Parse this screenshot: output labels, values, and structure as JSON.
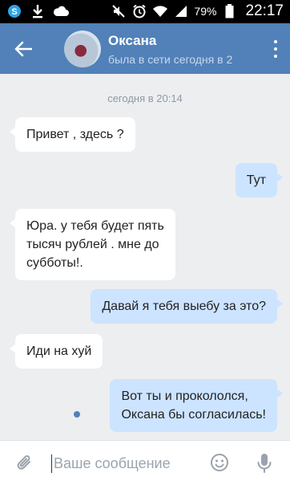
{
  "status_bar": {
    "battery": "79%",
    "time": "22:17"
  },
  "header": {
    "name": "Оксана",
    "last_seen": "была в сети сегодня в 2"
  },
  "chat": {
    "date_separator": "сегодня в 20:14",
    "messages": [
      {
        "direction": "incoming",
        "lines": [
          "Привет , здесь ?"
        ]
      },
      {
        "direction": "outgoing",
        "lines": [
          "Тут"
        ]
      },
      {
        "direction": "incoming",
        "lines": [
          "Юра. у тебя будет пять",
          "тысяч рублей . мне до",
          "субботы!."
        ]
      },
      {
        "direction": "outgoing",
        "lines": [
          "Давай я тебя выебу за это?"
        ]
      },
      {
        "direction": "incoming",
        "lines": [
          "Иди на хуй"
        ]
      },
      {
        "direction": "outgoing",
        "lines": [
          "Вот ты и прокололся,",
          "Оксана бы согласилась!"
        ],
        "unread": true
      }
    ]
  },
  "composer": {
    "placeholder": "Ваше сообщение"
  },
  "icons": {
    "back": "arrow-left-icon",
    "more": "more-vertical-icon",
    "attach": "paperclip-icon",
    "emoji": "smiley-icon",
    "mic": "microphone-icon"
  },
  "colors": {
    "header": "#5181b8",
    "background": "#edeef0",
    "outgoing_bubble": "#cce4ff",
    "incoming_bubble": "#ffffff"
  }
}
